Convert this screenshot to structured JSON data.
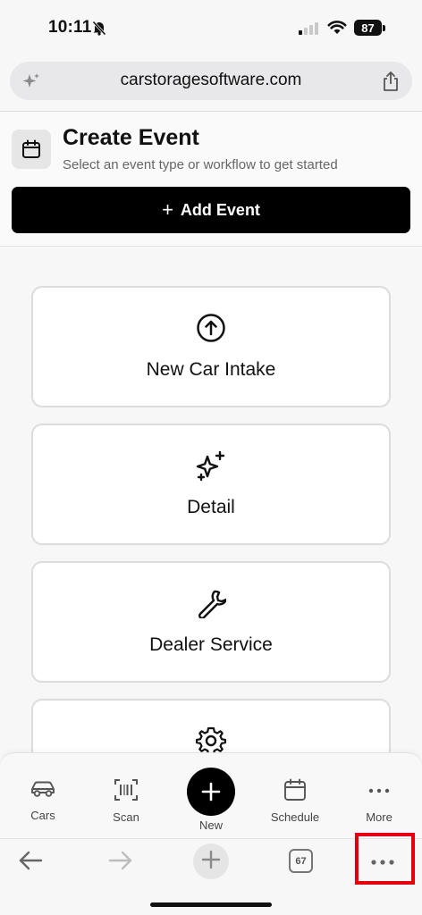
{
  "status_bar": {
    "time": "10:11",
    "battery": "87"
  },
  "browser": {
    "url": "carstoragesoftware.com",
    "tab_count": "67"
  },
  "header": {
    "title": "Create Event",
    "subtitle": "Select an event type or workflow to get started",
    "add_button": {
      "icon": "+",
      "label": "Add Event"
    }
  },
  "event_types": [
    {
      "label": "New Car Intake",
      "icon": "arrow-up-circle-icon"
    },
    {
      "label": "Detail",
      "icon": "sparkles-icon"
    },
    {
      "label": "Dealer Service",
      "icon": "wrench-icon"
    },
    {
      "label": "",
      "icon": "gear-icon"
    }
  ],
  "app_nav": {
    "items": [
      {
        "label": "Cars",
        "icon": "car-icon"
      },
      {
        "label": "Scan",
        "icon": "barcode-scan-icon"
      },
      {
        "label": "New",
        "icon": "plus-icon"
      },
      {
        "label": "Schedule",
        "icon": "calendar-icon"
      },
      {
        "label": "More",
        "icon": "ellipsis-icon"
      }
    ]
  },
  "colors": {
    "primary": "#000000",
    "highlight": "#e3000f"
  }
}
